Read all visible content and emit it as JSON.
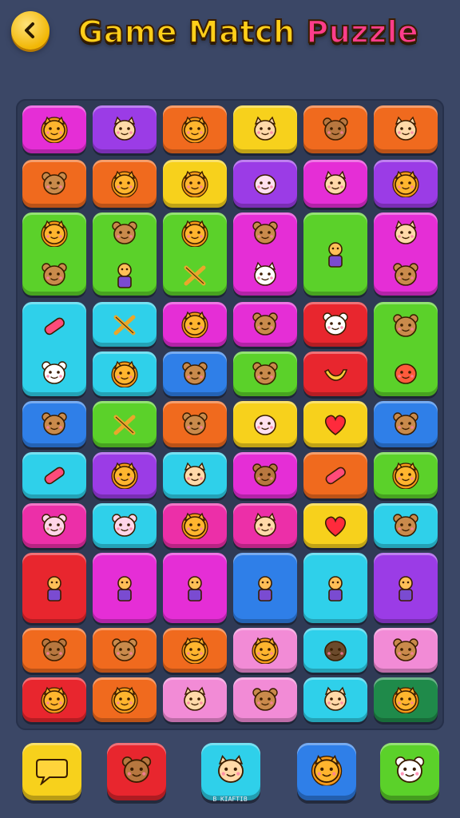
{
  "header": {
    "title_word1": "Game Match",
    "title_word2": "Puzzle",
    "back_icon": "chevron-left-icon"
  },
  "palette": {
    "magenta": "#e52ed6",
    "purple": "#9b3ce6",
    "orange": "#f06a1e",
    "yellow": "#f7d11c",
    "green": "#5bd12a",
    "pink": "#ec2fa8",
    "cyan": "#2fd0ea",
    "blue": "#2f7fe8",
    "red": "#e8262e",
    "lightpink": "#f28bd6",
    "teal": "#1f8a4a"
  },
  "board": {
    "tiles": [
      {
        "r": 0,
        "c": 0,
        "color": "magenta",
        "icons": [
          "lion"
        ]
      },
      {
        "r": 0,
        "c": 1,
        "color": "purple",
        "icons": [
          "cat"
        ]
      },
      {
        "r": 0,
        "c": 2,
        "color": "orange",
        "icons": [
          "lion"
        ]
      },
      {
        "r": 0,
        "c": 3,
        "color": "yellow",
        "icons": [
          "cat"
        ]
      },
      {
        "r": 0,
        "c": 4,
        "color": "orange",
        "icons": [
          "monkey"
        ]
      },
      {
        "r": 0,
        "c": 5,
        "color": "orange",
        "icons": [
          "cat"
        ]
      },
      {
        "r": 1,
        "c": 0,
        "color": "orange",
        "icons": [
          "bear"
        ]
      },
      {
        "r": 1,
        "c": 1,
        "color": "orange",
        "icons": [
          "lion"
        ]
      },
      {
        "r": 1,
        "c": 2,
        "color": "yellow",
        "icons": [
          "lion"
        ]
      },
      {
        "r": 1,
        "c": 3,
        "color": "purple",
        "icons": [
          "radish"
        ]
      },
      {
        "r": 1,
        "c": 4,
        "color": "magenta",
        "icons": [
          "cat"
        ]
      },
      {
        "r": 1,
        "c": 5,
        "color": "purple",
        "icons": [
          "lion"
        ]
      },
      {
        "r": 2,
        "c": 0,
        "color": "green",
        "tall": true,
        "icons": [
          "lion",
          "bear"
        ]
      },
      {
        "r": 2,
        "c": 1,
        "color": "green",
        "tall": true,
        "icons": [
          "bear",
          "figure"
        ]
      },
      {
        "r": 2,
        "c": 2,
        "color": "green",
        "tall": true,
        "icons": [
          "lion",
          "sticks"
        ]
      },
      {
        "r": 2,
        "c": 3,
        "color": "magenta",
        "tall": true,
        "icons": [
          "bear",
          "bunny"
        ]
      },
      {
        "r": 2,
        "c": 4,
        "color": "green",
        "tall": true,
        "icons": [
          "figure"
        ]
      },
      {
        "r": 2,
        "c": 5,
        "color": "magenta",
        "tall": true,
        "icons": [
          "cat",
          "bear"
        ]
      },
      {
        "r": 3,
        "c": 0,
        "color": "cyan",
        "tall": true,
        "icons": [
          "candy",
          "panda"
        ]
      },
      {
        "r": 3,
        "c": 1,
        "color": "cyan",
        "icons": [
          "sticks"
        ]
      },
      {
        "r": 3,
        "c": 2,
        "color": "magenta",
        "icons": [
          "lion"
        ]
      },
      {
        "r": 3,
        "c": 3,
        "color": "magenta",
        "icons": [
          "bear"
        ]
      },
      {
        "r": 3,
        "c": 4,
        "color": "red",
        "icons": [
          "panda"
        ]
      },
      {
        "r": 3,
        "c": 5,
        "color": "green",
        "tall": true,
        "icons": [
          "bear",
          "apple"
        ]
      },
      {
        "r": 4,
        "c": 1,
        "color": "cyan",
        "icons": [
          "lion"
        ]
      },
      {
        "r": 4,
        "c": 2,
        "color": "blue",
        "icons": [
          "bear"
        ]
      },
      {
        "r": 4,
        "c": 3,
        "color": "green",
        "icons": [
          "bear"
        ]
      },
      {
        "r": 4,
        "c": 4,
        "color": "red",
        "icons": [
          "banana"
        ]
      },
      {
        "r": 5,
        "c": 0,
        "color": "blue",
        "icons": [
          "bear"
        ]
      },
      {
        "r": 5,
        "c": 1,
        "color": "green",
        "icons": [
          "sticks"
        ]
      },
      {
        "r": 5,
        "c": 2,
        "color": "orange",
        "icons": [
          "bear"
        ]
      },
      {
        "r": 5,
        "c": 3,
        "color": "yellow",
        "icons": [
          "radish"
        ]
      },
      {
        "r": 5,
        "c": 4,
        "color": "yellow",
        "icons": [
          "heart"
        ]
      },
      {
        "r": 5,
        "c": 5,
        "color": "blue",
        "icons": [
          "bear"
        ]
      },
      {
        "r": 6,
        "c": 0,
        "color": "cyan",
        "icons": [
          "candy"
        ]
      },
      {
        "r": 6,
        "c": 1,
        "color": "purple",
        "icons": [
          "lion"
        ]
      },
      {
        "r": 6,
        "c": 2,
        "color": "cyan",
        "icons": [
          "cat"
        ]
      },
      {
        "r": 6,
        "c": 3,
        "color": "magenta",
        "icons": [
          "monkey"
        ]
      },
      {
        "r": 6,
        "c": 4,
        "color": "orange",
        "icons": [
          "candy"
        ]
      },
      {
        "r": 6,
        "c": 5,
        "color": "green",
        "icons": [
          "lion"
        ]
      },
      {
        "r": 7,
        "c": 0,
        "color": "pink",
        "icons": [
          "hippo"
        ]
      },
      {
        "r": 7,
        "c": 1,
        "color": "cyan",
        "icons": [
          "hippo"
        ]
      },
      {
        "r": 7,
        "c": 2,
        "color": "pink",
        "icons": [
          "lion"
        ]
      },
      {
        "r": 7,
        "c": 3,
        "color": "pink",
        "icons": [
          "cat"
        ]
      },
      {
        "r": 7,
        "c": 4,
        "color": "yellow",
        "icons": [
          "heart"
        ]
      },
      {
        "r": 7,
        "c": 5,
        "color": "cyan",
        "icons": [
          "bear"
        ]
      },
      {
        "r": 8,
        "c": 0,
        "color": "red",
        "tall": true,
        "icons": [
          "figure"
        ]
      },
      {
        "r": 8,
        "c": 1,
        "color": "magenta",
        "tall": true,
        "icons": [
          "figure"
        ]
      },
      {
        "r": 8,
        "c": 2,
        "color": "magenta",
        "tall": true,
        "icons": [
          "figure"
        ]
      },
      {
        "r": 8,
        "c": 3,
        "color": "blue",
        "tall": true,
        "icons": [
          "figure"
        ]
      },
      {
        "r": 8,
        "c": 4,
        "color": "cyan",
        "tall": true,
        "icons": [
          "figure"
        ]
      },
      {
        "r": 8,
        "c": 5,
        "color": "purple",
        "tall": true,
        "icons": [
          "figure"
        ]
      },
      {
        "r": 10,
        "c": 0,
        "color": "orange",
        "icons": [
          "monkey"
        ]
      },
      {
        "r": 10,
        "c": 1,
        "color": "orange",
        "icons": [
          "bear"
        ]
      },
      {
        "r": 10,
        "c": 2,
        "color": "orange",
        "icons": [
          "lion"
        ]
      },
      {
        "r": 10,
        "c": 3,
        "color": "lightpink",
        "icons": [
          "lion"
        ]
      },
      {
        "r": 10,
        "c": 4,
        "color": "cyan",
        "icons": [
          "coconut"
        ]
      },
      {
        "r": 10,
        "c": 5,
        "color": "lightpink",
        "icons": [
          "bear"
        ]
      },
      {
        "r": 11,
        "c": 0,
        "color": "red",
        "icons": [
          "lion"
        ]
      },
      {
        "r": 11,
        "c": 1,
        "color": "orange",
        "icons": [
          "lion"
        ]
      },
      {
        "r": 11,
        "c": 2,
        "color": "lightpink",
        "icons": [
          "cat"
        ]
      },
      {
        "r": 11,
        "c": 3,
        "color": "lightpink",
        "icons": [
          "bear"
        ]
      },
      {
        "r": 11,
        "c": 4,
        "color": "cyan",
        "icons": [
          "cat"
        ]
      },
      {
        "r": 11,
        "c": 5,
        "color": "teal",
        "icons": [
          "lion"
        ]
      }
    ]
  },
  "dock": {
    "buttons": [
      {
        "color": "yellow",
        "icon": "chat-bubble-icon"
      },
      {
        "color": "red",
        "icon": "monkey-icon"
      },
      {
        "color": "cyan",
        "icon": "fish-icon"
      },
      {
        "color": "blue",
        "icon": "lion-icon"
      },
      {
        "color": "green",
        "icon": "bear-icon"
      }
    ],
    "caption": "B KIAFTIB"
  }
}
